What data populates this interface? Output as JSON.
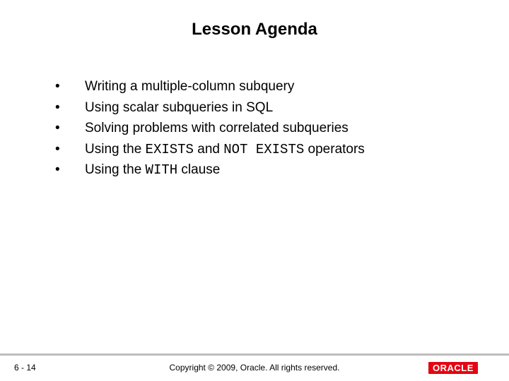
{
  "title": "Lesson Agenda",
  "bullets": {
    "b0": "Writing a multiple-column subquery",
    "b1": "Using scalar subqueries in SQL",
    "b2": "Solving problems with correlated subqueries",
    "b3_pre": "Using the ",
    "b3_code1": "EXISTS",
    "b3_mid": " and ",
    "b3_code2": "NOT EXISTS",
    "b3_post": " operators",
    "b4_pre": "Using the ",
    "b4_code": "WITH",
    "b4_post": " clause"
  },
  "footer": {
    "page": "6 - 14",
    "copyright": "Copyright © 2009, Oracle. All rights reserved.",
    "logo_text": "ORACLE"
  }
}
